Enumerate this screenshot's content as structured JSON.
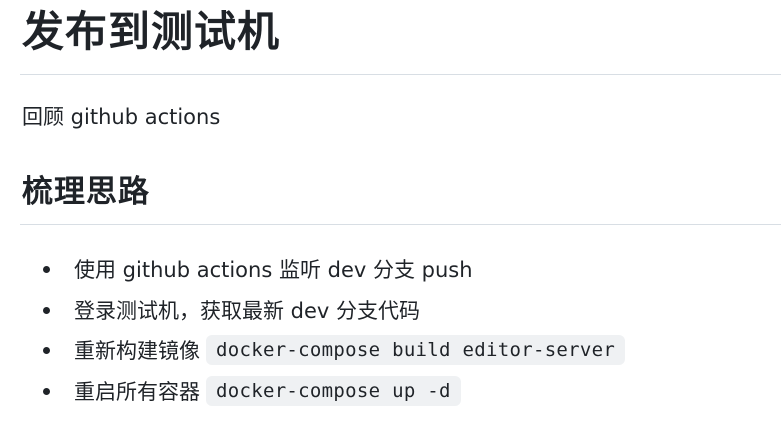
{
  "title": "发布到测试机",
  "intro": "回顾 github actions",
  "section": {
    "heading": "梳理思路",
    "items": [
      {
        "text": "使用 github actions 监听 dev 分支 push",
        "code": ""
      },
      {
        "text": "登录测试机，获取最新 dev 分支代码",
        "code": ""
      },
      {
        "text": "重新构建镜像",
        "code": "docker-compose build editor-server"
      },
      {
        "text": "重启所有容器",
        "code": "docker-compose up -d"
      }
    ]
  }
}
